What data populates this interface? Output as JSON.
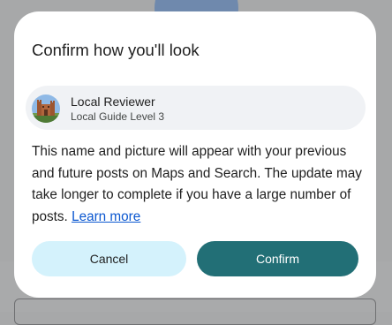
{
  "dialog": {
    "title": "Confirm how you'll look",
    "profile": {
      "name": "Local Reviewer",
      "subtitle": "Local Guide Level 3",
      "avatar_icon": "castle-photo-avatar"
    },
    "body_text": "This name and picture will appear with your previous and future posts on Maps and Search. The update may take longer to complete if you have a large number of posts.",
    "learn_more_label": "Learn more",
    "cancel_label": "Cancel",
    "confirm_label": "Confirm"
  },
  "colors": {
    "scrim": "#a7a8a9",
    "dialog_background": "#ffffff",
    "profile_chip": "#f0f2f5",
    "cancel_button": "#d4f2fc",
    "confirm_button": "#226f76",
    "link": "#0b57d0"
  }
}
